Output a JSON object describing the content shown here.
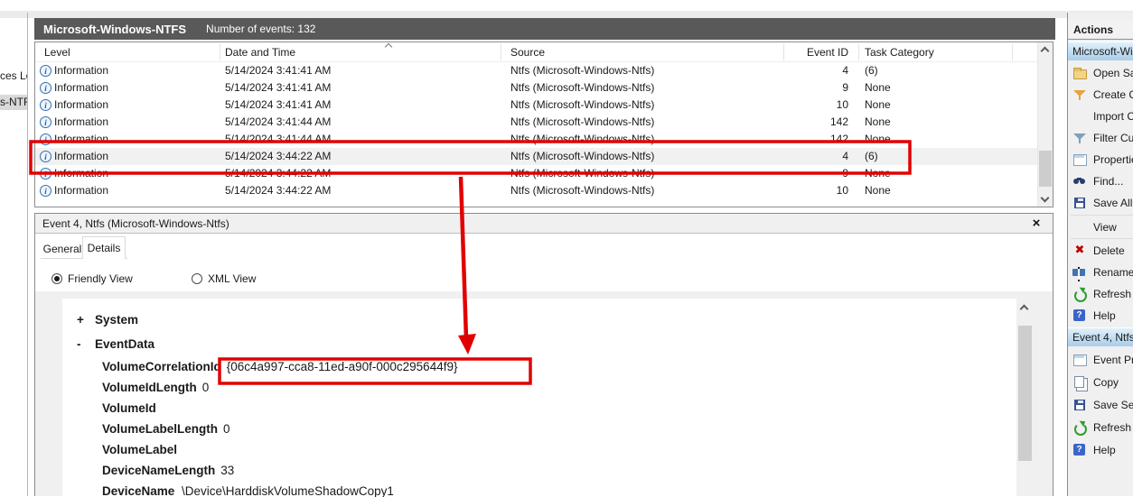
{
  "window": {
    "log_title": "Microsoft-Windows-NTFS",
    "event_count_label": "Number of events: 132"
  },
  "console_tree": {
    "items": [
      {
        "label": "ces Lo",
        "selected": false
      },
      {
        "label": "s-NTF",
        "selected": true
      }
    ]
  },
  "event_table": {
    "columns": [
      "Level",
      "Date and Time",
      "Source",
      "Event ID",
      "Task Category"
    ],
    "sorted_by": "Date and Time",
    "sort_direction": "ascending",
    "rows": [
      {
        "level": "Information",
        "datetime": "5/14/2024 3:41:41 AM",
        "source": "Ntfs (Microsoft-Windows-Ntfs)",
        "event_id": "4",
        "task_category": "(6)",
        "highlighted": false
      },
      {
        "level": "Information",
        "datetime": "5/14/2024 3:41:41 AM",
        "source": "Ntfs (Microsoft-Windows-Ntfs)",
        "event_id": "9",
        "task_category": "None",
        "highlighted": false
      },
      {
        "level": "Information",
        "datetime": "5/14/2024 3:41:41 AM",
        "source": "Ntfs (Microsoft-Windows-Ntfs)",
        "event_id": "10",
        "task_category": "None",
        "highlighted": false
      },
      {
        "level": "Information",
        "datetime": "5/14/2024 3:41:44 AM",
        "source": "Ntfs (Microsoft-Windows-Ntfs)",
        "event_id": "142",
        "task_category": "None",
        "highlighted": false
      },
      {
        "level": "Information",
        "datetime": "5/14/2024 3:41:44 AM",
        "source": "Ntfs (Microsoft-Windows-Ntfs)",
        "event_id": "142",
        "task_category": "None",
        "highlighted": false
      },
      {
        "level": "Information",
        "datetime": "5/14/2024 3:44:22 AM",
        "source": "Ntfs (Microsoft-Windows-Ntfs)",
        "event_id": "4",
        "task_category": "(6)",
        "highlighted": true
      },
      {
        "level": "Information",
        "datetime": "5/14/2024 3:44:22 AM",
        "source": "Ntfs (Microsoft-Windows-Ntfs)",
        "event_id": "9",
        "task_category": "None",
        "highlighted": false
      },
      {
        "level": "Information",
        "datetime": "5/14/2024 3:44:22 AM",
        "source": "Ntfs (Microsoft-Windows-Ntfs)",
        "event_id": "10",
        "task_category": "None",
        "highlighted": false
      }
    ]
  },
  "details_pane": {
    "title": "Event 4, Ntfs (Microsoft-Windows-Ntfs)",
    "close_glyph": "×",
    "tabs": [
      {
        "label": "General",
        "active": false
      },
      {
        "label": "Details",
        "active": true
      }
    ],
    "view_options": [
      {
        "label": "Friendly View",
        "selected": true
      },
      {
        "label": "XML View",
        "selected": false
      }
    ],
    "tree": {
      "nodes": [
        {
          "toggle": "+",
          "label": "System",
          "expanded": false
        },
        {
          "toggle": "-",
          "label": "EventData",
          "expanded": true
        }
      ],
      "fields": [
        {
          "name": "VolumeCorrelationId",
          "value": "{06c4a997-cca8-11ed-a90f-000c295644f9}",
          "annotated": true
        },
        {
          "name": "VolumeIdLength",
          "value": "0"
        },
        {
          "name": "VolumeId",
          "value": ""
        },
        {
          "name": "VolumeLabelLength",
          "value": "0"
        },
        {
          "name": "VolumeLabel",
          "value": ""
        },
        {
          "name": "DeviceNameLength",
          "value": "33"
        },
        {
          "name": "DeviceName",
          "value": "\\Device\\HarddiskVolumeShadowCopy1"
        }
      ]
    }
  },
  "actions_panel": {
    "title": "Actions",
    "sections": [
      {
        "header": "Microsoft-Wi",
        "items": [
          {
            "label": "Open Sav",
            "icon": "open-folder-icon"
          },
          {
            "label": "Create C",
            "icon": "create-filter-icon"
          },
          {
            "label": "Import C",
            "icon": "none"
          },
          {
            "label": "Filter Cu",
            "icon": "filter-funnel-icon"
          },
          {
            "label": "Propertie",
            "icon": "properties-icon"
          },
          {
            "label": "Find...",
            "icon": "binoculars-icon"
          },
          {
            "label": "Save All",
            "icon": "save-icon"
          },
          {
            "label": "View",
            "icon": "none"
          },
          {
            "label": "Delete",
            "icon": "delete-x-icon"
          },
          {
            "label": "Rename",
            "icon": "rename-icon"
          },
          {
            "label": "Refresh",
            "icon": "refresh-icon"
          },
          {
            "label": "Help",
            "icon": "help-icon"
          }
        ]
      },
      {
        "header": "Event 4, Ntfs",
        "items": [
          {
            "label": "Event Pr",
            "icon": "properties-icon"
          },
          {
            "label": "Copy",
            "icon": "copy-icon"
          },
          {
            "label": "Save Sele",
            "icon": "save-icon"
          },
          {
            "label": "Refresh",
            "icon": "refresh-icon"
          },
          {
            "label": "Help",
            "icon": "help-icon"
          }
        ]
      }
    ]
  },
  "annotations": {
    "color": "#e10000",
    "marks": [
      "box-around-selected-event-row",
      "arrow-to-volume-correlation-id",
      "box-around-guid-value"
    ]
  }
}
